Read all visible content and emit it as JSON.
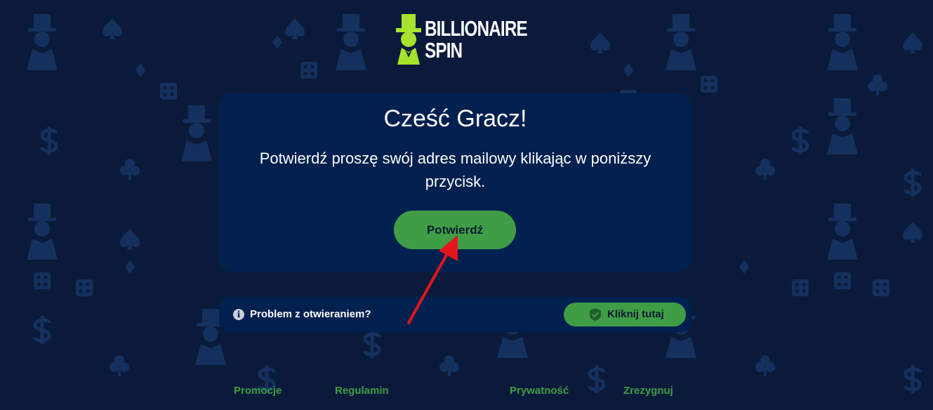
{
  "brand": {
    "name_line1": "BILLIONAIRE",
    "name_line2": "SPIN",
    "accent_color": "#a6e22e"
  },
  "card": {
    "title": "Cześć Gracz!",
    "message": "Potwierdź proszę swój adres mailowy klikając w poniższy przycisk.",
    "confirm_label": "Potwierdź"
  },
  "help": {
    "question": "Problem z otwieraniem?",
    "button_label": "Kliknij tutaj",
    "info_icon": "info-icon",
    "shield_icon": "shield-icon"
  },
  "footer": {
    "links": [
      "Promocje",
      "Regulamin",
      "Prywatność",
      "Zrezygnuj"
    ]
  },
  "colors": {
    "background": "#0b1a3a",
    "card": "#00204f",
    "button": "#3f9e45",
    "arrow": "#e4161b"
  }
}
